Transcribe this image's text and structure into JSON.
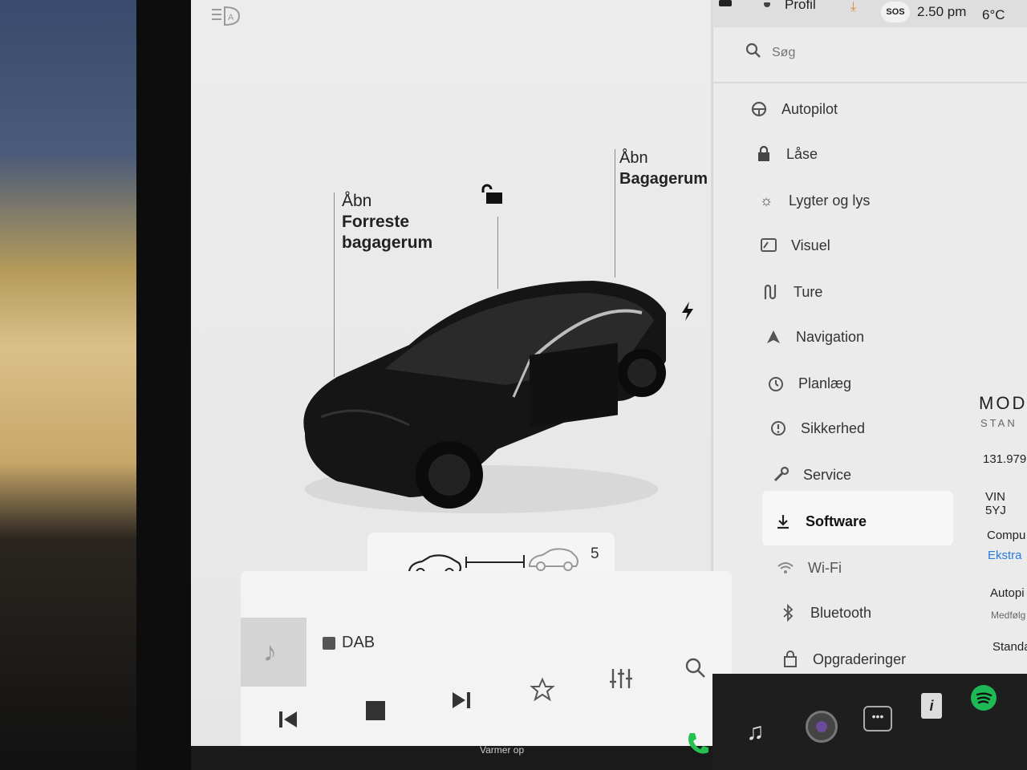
{
  "status": {
    "profile": "Profil",
    "sos": "SOS",
    "time": "2.50 pm",
    "temp": "6°C"
  },
  "search": {
    "placeholder": "Søg"
  },
  "menu": [
    {
      "label": "Autopilot",
      "icon": "steering-wheel-icon"
    },
    {
      "label": "Låse",
      "icon": "lock-icon"
    },
    {
      "label": "Lygter og lys",
      "icon": "light-icon"
    },
    {
      "label": "Visuel",
      "icon": "display-icon"
    },
    {
      "label": "Ture",
      "icon": "trips-icon"
    },
    {
      "label": "Navigation",
      "icon": "navigation-icon"
    },
    {
      "label": "Planlæg",
      "icon": "clock-icon"
    },
    {
      "label": "Sikkerhed",
      "icon": "safety-icon"
    },
    {
      "label": "Service",
      "icon": "wrench-icon"
    },
    {
      "label": "Software",
      "icon": "download-icon",
      "selected": true
    },
    {
      "label": "Wi-Fi",
      "icon": "wifi-icon"
    },
    {
      "label": "Bluetooth",
      "icon": "bluetooth-icon"
    },
    {
      "label": "Opgraderinger",
      "icon": "bag-icon"
    }
  ],
  "car": {
    "front_trunk_line1": "Åbn",
    "front_trunk_line2": "Forreste",
    "front_trunk_line3": "bagagerum",
    "trunk_line1": "Åbn",
    "trunk_line2": "Bagagerum",
    "ride_height_value": "5"
  },
  "info": {
    "model_partial": "MOD",
    "standard_partial": "STAN",
    "odometer": "131.979",
    "vin_partial": "VIN 5YJ",
    "computer_partial": "Compu",
    "extra_partial": "Ekstra",
    "autopilot_partial": "Autopi",
    "included_partial": "Medfølg",
    "standard2_partial": "Standa"
  },
  "media": {
    "source": "DAB"
  },
  "bottom": {
    "climate": "Varmer op"
  },
  "colors": {
    "accent": "#2a7ae2",
    "spotify": "#1db954",
    "phone": "#27c152"
  }
}
